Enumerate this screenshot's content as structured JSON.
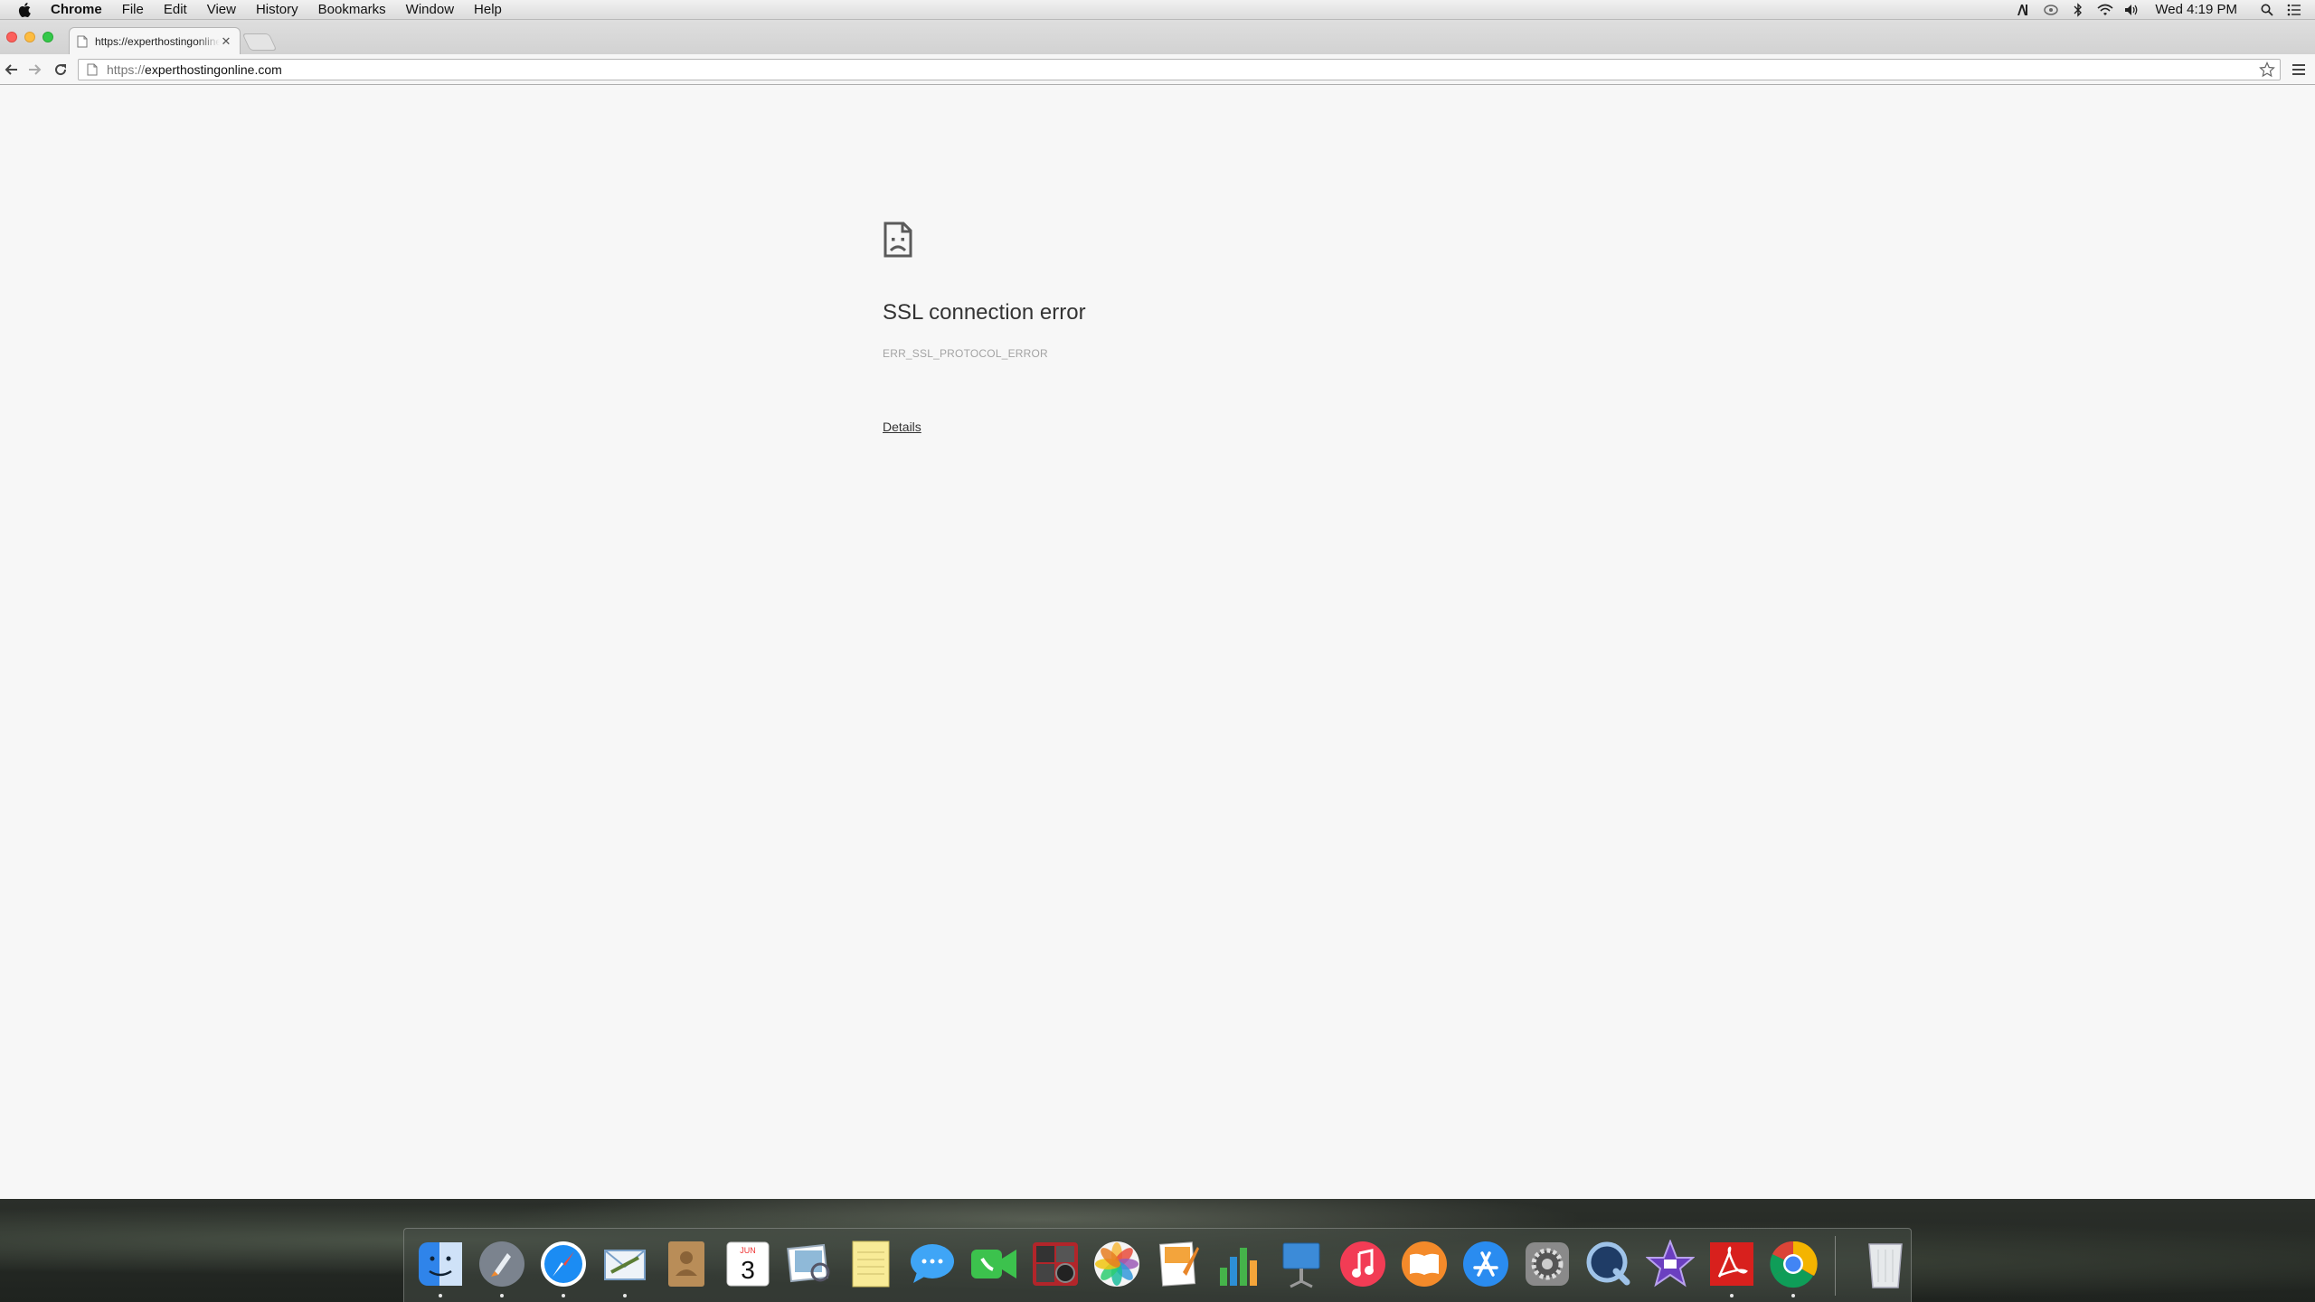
{
  "menubar": {
    "app_name": "Chrome",
    "items": [
      "File",
      "Edit",
      "View",
      "History",
      "Bookmarks",
      "Window",
      "Help"
    ],
    "clock": "Wed 4:19 PM",
    "status_icons": [
      "adobe-creative-cloud-icon",
      "spotlight-status-icon",
      "bluetooth-icon",
      "wifi-icon",
      "volume-icon",
      "search-icon",
      "notification-center-icon"
    ]
  },
  "tab": {
    "title": "https://experthostingonline.com"
  },
  "omnibox": {
    "url_scheme": "https://",
    "url_host": "experthostingonline.com"
  },
  "error": {
    "title": "SSL connection error",
    "code": "ERR_SSL_PROTOCOL_ERROR",
    "details_label": "Details"
  },
  "dock": {
    "apps": [
      {
        "name": "finder-icon",
        "color": "#3a8ef0"
      },
      {
        "name": "launchpad-icon",
        "color": "#6c7480"
      },
      {
        "name": "safari-icon",
        "color": "#1c8ef2"
      },
      {
        "name": "mail-icon",
        "color": "#5fa8e8"
      },
      {
        "name": "contacts-icon",
        "color": "#b98d58"
      },
      {
        "name": "calendar-icon",
        "color": "#ffffff"
      },
      {
        "name": "preview-icon",
        "color": "#8fb9d8"
      },
      {
        "name": "notes-icon",
        "color": "#f5e27a"
      },
      {
        "name": "messages-icon",
        "color": "#3fa5f6"
      },
      {
        "name": "facetime-icon",
        "color": "#3cc24d"
      },
      {
        "name": "photo-booth-icon",
        "color": "#b2252a"
      },
      {
        "name": "photos-icon",
        "color": "#f4f4f4"
      },
      {
        "name": "pages-icon",
        "color": "#f3a43c"
      },
      {
        "name": "numbers-icon",
        "color": "#45b34a"
      },
      {
        "name": "keynote-icon",
        "color": "#3c8bd8"
      },
      {
        "name": "itunes-icon",
        "color": "#f23c55"
      },
      {
        "name": "ibooks-icon",
        "color": "#f48a2a"
      },
      {
        "name": "app-store-icon",
        "color": "#2a8cf0"
      },
      {
        "name": "system-preferences-icon",
        "color": "#8a8a8a"
      },
      {
        "name": "quicktime-icon",
        "color": "#1f3c66"
      },
      {
        "name": "imovie-icon",
        "color": "#6b3fc0"
      },
      {
        "name": "acrobat-icon",
        "color": "#d8201d"
      },
      {
        "name": "chrome-icon",
        "color": "#ffffff"
      },
      {
        "name": "trash-icon",
        "color": "#d7dadc"
      }
    ],
    "calendar_month": "JUN",
    "calendar_day": "3"
  }
}
